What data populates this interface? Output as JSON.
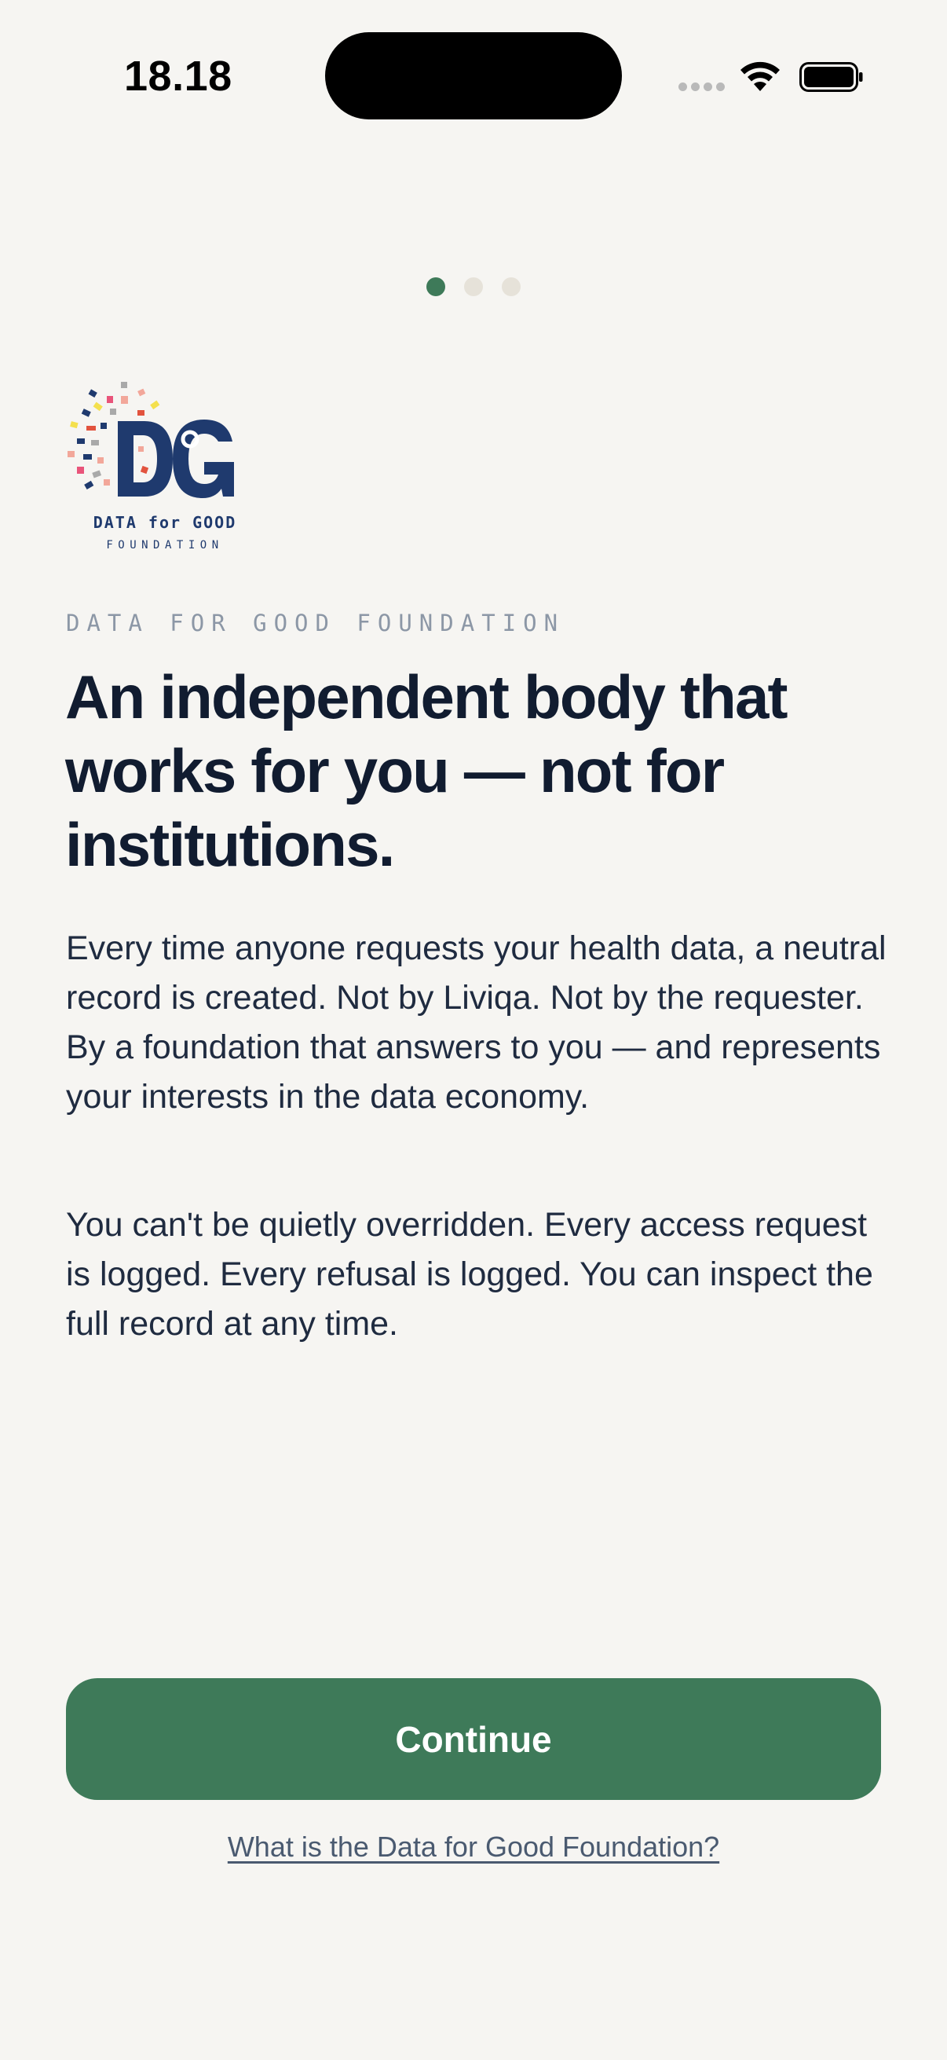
{
  "status_bar": {
    "time": "18.18",
    "icons": [
      "cellular-signal-icon",
      "wifi-icon",
      "battery-icon"
    ]
  },
  "pager": {
    "total": 3,
    "active_index": 0
  },
  "logo": {
    "name": "data-for-good-foundation-logo",
    "monogram": "DG",
    "line1": "DATA for GOOD",
    "line2": "FOUNDATION"
  },
  "eyebrow": "DATA FOR GOOD FOUNDATION",
  "headline": "An independent body that works for you — not for institutions.",
  "paragraphs": [
    "Every time anyone requests your health data, a neutral record is created. Not by Liviqa. Not by the requester. By a foundation that answers to you — and represents your interests in the data economy.",
    "You can't be quietly overridden. Every access request is logged. Every refusal is logged. You can inspect the full record at any time."
  ],
  "actions": {
    "continue_label": "Continue",
    "info_link": "What is the Data for Good Foundation?"
  },
  "colors": {
    "background": "#f6f5f2",
    "accent": "#3e7a59",
    "headline": "#111c30",
    "logo_navy": "#1f3a6e"
  }
}
